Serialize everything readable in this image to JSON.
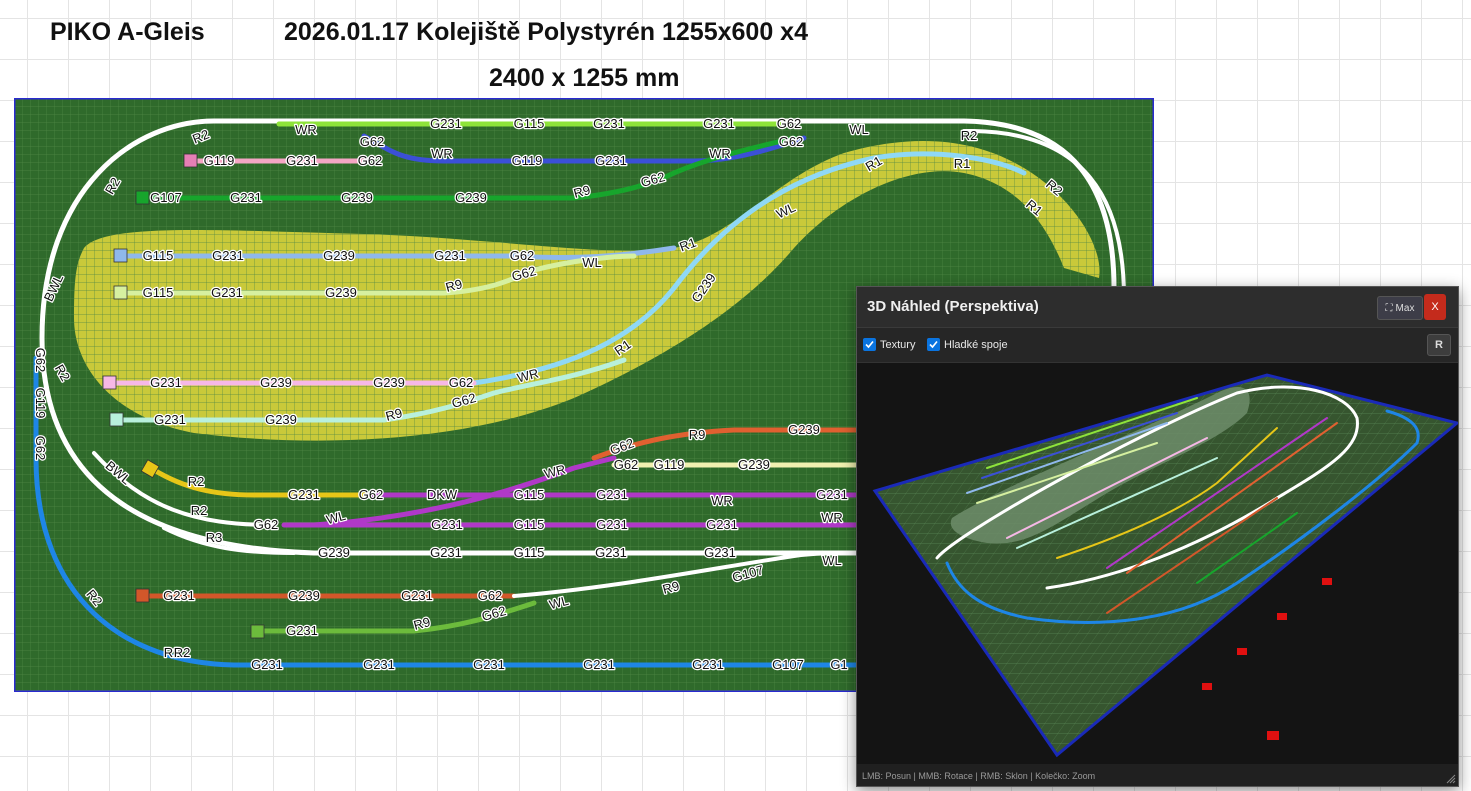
{
  "header": {
    "brand": "PIKO A-Gleis",
    "title": "2026.01.17 Kolejiště Polystyrén 1255x600 x4",
    "dimensions": "2400 x 1255 mm"
  },
  "layout": {
    "colors": {
      "board": "#2f6a2b",
      "hill": "#c9c93a",
      "outer_loop": "#ffffff",
      "blue_loop": "#1e86e6",
      "lime": "#8ee33a",
      "pink": "#f4a6c4",
      "royal_blue": "#3b50d6",
      "green": "#17a52c",
      "light_blue": "#8fb8ec",
      "light_green": "#d6f0a0",
      "light_pink": "#f6b8e6",
      "sky": "#8fd8f6",
      "mint": "#b8f0dc",
      "yellow": "#e7c618",
      "purple": "#b038c8",
      "orange": "#e06030",
      "rust": "#d2572a",
      "grass_green": "#6cbb3c"
    },
    "track_labels": [
      {
        "text": "R2"
      },
      {
        "text": "WR"
      },
      {
        "text": "G62"
      },
      {
        "text": "G231"
      },
      {
        "text": "G115"
      },
      {
        "text": "G231"
      },
      {
        "text": "G231"
      },
      {
        "text": "G62"
      },
      {
        "text": "WL"
      },
      {
        "text": "R2"
      },
      {
        "text": "G119"
      },
      {
        "text": "G231"
      },
      {
        "text": "G62"
      },
      {
        "text": "WR"
      },
      {
        "text": "G119"
      },
      {
        "text": "G231"
      },
      {
        "text": "WR"
      },
      {
        "text": "G62"
      },
      {
        "text": "R2"
      },
      {
        "text": "G107"
      },
      {
        "text": "G231"
      },
      {
        "text": "G239"
      },
      {
        "text": "G239"
      },
      {
        "text": "R9"
      },
      {
        "text": "G62"
      },
      {
        "text": "R1"
      },
      {
        "text": "R1"
      },
      {
        "text": "R2"
      },
      {
        "text": "R1"
      },
      {
        "text": "WL"
      },
      {
        "text": "G115"
      },
      {
        "text": "G231"
      },
      {
        "text": "G239"
      },
      {
        "text": "G231"
      },
      {
        "text": "G62"
      },
      {
        "text": "G62"
      },
      {
        "text": "WL"
      },
      {
        "text": "R1"
      },
      {
        "text": "BWL"
      },
      {
        "text": "G115"
      },
      {
        "text": "G231"
      },
      {
        "text": "G239"
      },
      {
        "text": "R9"
      },
      {
        "text": "G239"
      },
      {
        "text": "G62"
      },
      {
        "text": "R2"
      },
      {
        "text": "G119"
      },
      {
        "text": "G62"
      },
      {
        "text": "R1"
      },
      {
        "text": "G231"
      },
      {
        "text": "G239"
      },
      {
        "text": "G239"
      },
      {
        "text": "G62"
      },
      {
        "text": "WR"
      },
      {
        "text": "G62"
      },
      {
        "text": "G231"
      },
      {
        "text": "G239"
      },
      {
        "text": "R9"
      },
      {
        "text": "G62"
      },
      {
        "text": "R9"
      },
      {
        "text": "G239"
      },
      {
        "text": "BWL"
      },
      {
        "text": "WR"
      },
      {
        "text": "G62"
      },
      {
        "text": "G119"
      },
      {
        "text": "G239"
      },
      {
        "text": "R2"
      },
      {
        "text": "G231"
      },
      {
        "text": "G62"
      },
      {
        "text": "DKW"
      },
      {
        "text": "G115"
      },
      {
        "text": "G231"
      },
      {
        "text": "WR"
      },
      {
        "text": "G231"
      },
      {
        "text": "R2"
      },
      {
        "text": "G62"
      },
      {
        "text": "WL"
      },
      {
        "text": "G231"
      },
      {
        "text": "G115"
      },
      {
        "text": "G231"
      },
      {
        "text": "G231"
      },
      {
        "text": "WR"
      },
      {
        "text": "R3"
      },
      {
        "text": "G239"
      },
      {
        "text": "G231"
      },
      {
        "text": "G115"
      },
      {
        "text": "G231"
      },
      {
        "text": "G231"
      },
      {
        "text": "WL"
      },
      {
        "text": "R2"
      },
      {
        "text": "G231"
      },
      {
        "text": "G239"
      },
      {
        "text": "G231"
      },
      {
        "text": "G62"
      },
      {
        "text": "WL"
      },
      {
        "text": "R9"
      },
      {
        "text": "G107"
      },
      {
        "text": "R2"
      },
      {
        "text": "G231"
      },
      {
        "text": "R9"
      },
      {
        "text": "G62"
      },
      {
        "text": "R2"
      },
      {
        "text": "G231"
      },
      {
        "text": "G231"
      },
      {
        "text": "G231"
      },
      {
        "text": "G231"
      },
      {
        "text": "G231"
      },
      {
        "text": "G107"
      },
      {
        "text": "G1"
      },
      {
        "text": "R2"
      },
      {
        "text": "G62"
      },
      {
        "text": "G119"
      },
      {
        "text": "G62"
      },
      {
        "text": "BW"
      },
      {
        "text": "R"
      }
    ]
  },
  "preview_window": {
    "title": "3D Náhled (Perspektiva)",
    "max_label": "Max",
    "max_icon": "fullscreen-icon",
    "close_label": "X",
    "checkboxes": [
      {
        "label": "Textury",
        "checked": true
      },
      {
        "label": "Hladké spoje",
        "checked": true
      }
    ],
    "reset_label": "R",
    "status": "LMB: Posun | MMB: Rotace | RMB: Sklon | Kolečko: Zoom"
  }
}
